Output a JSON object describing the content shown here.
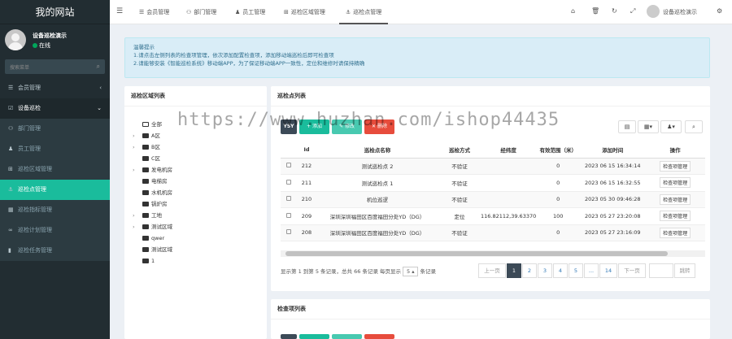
{
  "brand": "我的网站",
  "user": {
    "name": "设备巡检演示",
    "status": "在线"
  },
  "search_placeholder": "搜索菜单",
  "menu": [
    {
      "label": "会员管理",
      "icon": "list-icon",
      "arrow": "‹"
    },
    {
      "label": "设备巡检",
      "icon": "checkbox-icon",
      "arrow": "⌄"
    },
    {
      "label": "部门管理",
      "icon": "users-icon",
      "arrow": ""
    },
    {
      "label": "员工管理",
      "icon": "user-icon",
      "arrow": ""
    },
    {
      "label": "巡检区域管理",
      "icon": "sitemap-icon",
      "arrow": ""
    },
    {
      "label": "巡检点管理",
      "icon": "anchor-icon",
      "arrow": ""
    },
    {
      "label": "巡检指标管理",
      "icon": "chart-icon",
      "arrow": ""
    },
    {
      "label": "巡检计划管理",
      "icon": "link-icon",
      "arrow": ""
    },
    {
      "label": "巡检任务管理",
      "icon": "book-icon",
      "arrow": ""
    }
  ],
  "tabs": [
    "会员管理",
    "部门管理",
    "员工管理",
    "巡检区域管理",
    "巡检点管理"
  ],
  "top_user": "设备巡检演示",
  "alert": {
    "title": "温馨提示",
    "line1": "1.请点击左侧列表的检查项管理，依次添加配置检查项，添加移动端巡检后即可检查项",
    "line2": "2.请能够安装《智能巡检系统》移动端APP，为了保证移动端APP一致性，定位和维修时请保持精确"
  },
  "left_panel_title": "巡检区域列表",
  "tree": [
    {
      "label": "全部",
      "expand": "",
      "open": true,
      "indent": 0
    },
    {
      "label": "A区",
      "expand": "›",
      "open": false,
      "indent": 0
    },
    {
      "label": "B区",
      "expand": "›",
      "open": false,
      "indent": 0
    },
    {
      "label": "C区",
      "expand": "",
      "open": false,
      "indent": 0
    },
    {
      "label": "发电机房",
      "expand": "›",
      "open": false,
      "indent": 0
    },
    {
      "label": "电梯房",
      "expand": "",
      "open": false,
      "indent": 0
    },
    {
      "label": "水机机房",
      "expand": "",
      "open": false,
      "indent": 0
    },
    {
      "label": "锅炉房",
      "expand": "",
      "open": false,
      "indent": 0
    },
    {
      "label": "工地",
      "expand": "›",
      "open": false,
      "indent": 0
    },
    {
      "label": "测试区域",
      "expand": "›",
      "open": false,
      "indent": 0
    },
    {
      "label": "qwer",
      "expand": "",
      "open": false,
      "indent": 0
    },
    {
      "label": "测试区域",
      "expand": "",
      "open": false,
      "indent": 0
    },
    {
      "label": "1",
      "expand": "",
      "open": false,
      "indent": 0
    }
  ],
  "right_panel_title": "巡检点列表",
  "toolbar": {
    "add": "+ 添加",
    "edit": "✎ 修改",
    "delete": "✕ 删除",
    "ysy": "YSY"
  },
  "table": {
    "headers": [
      "",
      "Id",
      "巡检点名称",
      "巡检方式",
      "经纬度",
      "有效范围（米）",
      "添加时间",
      "操作"
    ],
    "rows": [
      {
        "id": "212",
        "name": "测试巡检点 2",
        "mode": "不验证",
        "geo": "",
        "range": "0",
        "time": "2023 06 15 16:34:14",
        "op": "检查项管理"
      },
      {
        "id": "211",
        "name": "测试巡检点 1",
        "mode": "不验证",
        "geo": "",
        "range": "0",
        "time": "2023 06 15 16:32:55",
        "op": "检查项管理"
      },
      {
        "id": "210",
        "name": "机位巡逻",
        "mode": "不验证",
        "geo": "",
        "range": "0",
        "time": "2023 05 30 09:46:28",
        "op": "检查项管理"
      },
      {
        "id": "209",
        "name": "深圳深圳福田区百度福田分处YD（DG）",
        "mode": "定位",
        "geo": "116.82112,39.63370",
        "range": "100",
        "time": "2023 05 27 23:20:08",
        "op": "检查项管理"
      },
      {
        "id": "208",
        "name": "深圳深圳福田区百度福田分处YD（DG）",
        "mode": "不验证",
        "geo": "",
        "range": "0",
        "time": "2023 05 27 23:16:09",
        "op": "检查项管理"
      }
    ]
  },
  "pagination": {
    "info_prefix": "显示第 1 到第 5 条记录，总共 66 条记录 每页显示",
    "page_size": "5 ▴",
    "info_suffix": "条记录",
    "prev": "上一页",
    "pages": [
      "1",
      "2",
      "3",
      "4",
      "5",
      "...",
      "14"
    ],
    "next": "下一页",
    "jump": "跳转"
  },
  "bottom_panel_title": "检查项列表",
  "watermark": "https://www.huzhan.com/ishop44435",
  "colors": {
    "sidebar": "#222d32",
    "active": "#1abc9c",
    "add": "#1abc9c",
    "edit": "#48c9b0",
    "delete": "#e74c3c"
  }
}
